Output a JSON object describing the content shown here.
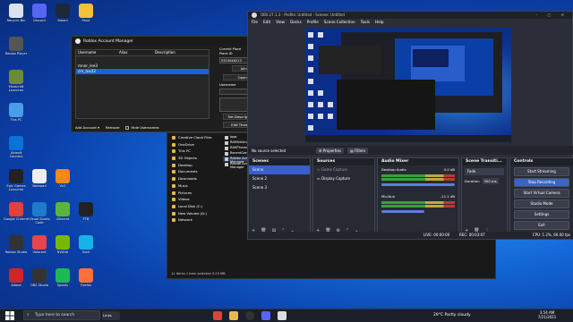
{
  "desktop": {
    "icons": [
      {
        "label": "Recycle Bin",
        "color": "#d9e2ee"
      },
      {
        "label": "Roblox Player",
        "color": "#555"
      },
      {
        "label": "Minecraft Launcher",
        "color": "#6b8a3a"
      },
      {
        "label": "This PC",
        "color": "#4a9de8"
      },
      {
        "label": "Ubisoft Connect",
        "color": "#0a73d8"
      },
      {
        "label": "Epic Games Launcher",
        "color": "#222"
      },
      {
        "label": "Google Chrome",
        "color": "#e0413a"
      },
      {
        "label": "Roblox Studio",
        "color": "#333"
      },
      {
        "label": "Adobe",
        "color": "#d0232a"
      },
      {
        "label": "Discord",
        "color": "#5865f2"
      },
      {
        "label": "Notepad",
        "color": "#eee"
      },
      {
        "label": "Visual Studio Code",
        "color": "#1f7acc"
      },
      {
        "label": "Valorant",
        "color": "#e5454f"
      },
      {
        "label": "OBS Studio",
        "color": "#333"
      },
      {
        "label": "Steam",
        "color": "#1b2838"
      },
      {
        "label": "VLC",
        "color": "#f08a1c"
      },
      {
        "label": "uTorrent",
        "color": "#5bb53c"
      },
      {
        "label": "NVIDIA",
        "color": "#76b900"
      },
      {
        "label": "Spotify",
        "color": "#1db954"
      },
      {
        "label": "Paint",
        "color": "#f4c037"
      },
      {
        "label": "FTB",
        "color": "#222"
      },
      {
        "label": "Kodi",
        "color": "#17b2e7"
      },
      {
        "label": "Firefox",
        "color": "#ff7139"
      },
      {
        "label": "Shortcut",
        "color": "#eee"
      }
    ]
  },
  "ram": {
    "title": "Roblox Account Manager",
    "columns": [
      "Username",
      "Alias",
      "Description"
    ],
    "accounts": [
      "mnor_lee3",
      "cm_lux22"
    ],
    "current_place_label": "Current Place",
    "place_id_label": "Place ID",
    "place_id": "5315046213",
    "userid_label": "UserID",
    "job_id_label": "Job ID",
    "buttons": {
      "join_server": "Join Server",
      "utilities": "Utilities",
      "open_browser": "Open Browser",
      "follow": "Follow",
      "set_alias": "Set Alias",
      "set_description": "Set Description",
      "account_utilities": "Account Utilities",
      "edit_theme": "Edit Theme",
      "account_control": "Account Control",
      "add_account": "Add Account",
      "remove": "Remove",
      "hide_usernames": "Hide Usernames"
    },
    "username_label": "Username"
  },
  "explorer": {
    "nav": [
      "Creative Cloud Files",
      "OneDrive",
      "This PC",
      "3D Objects",
      "Desktop",
      "Documents",
      "Downloads",
      "Music",
      "Pictures",
      "Videos",
      "Local Disk (C:)",
      "New Volume (D:)",
      "Network"
    ],
    "files": [
      "logs",
      "RAMSettings",
      "RAMTheme",
      "RecentGames",
      "Roblox Account Manager",
      "Roblox Account Manager"
    ],
    "status": "11 items    1 item selected  3.23 MB"
  },
  "obs": {
    "title": "OBS 27.1.3 - Profile: Untitled - Scenes: Untitled",
    "menu": [
      "File",
      "Edit",
      "View",
      "Docks",
      "Profile",
      "Scene Collection",
      "Tools",
      "Help"
    ],
    "no_source": "No source selected",
    "properties": "Properties",
    "filters": "Filters",
    "scenes": {
      "title": "Scenes",
      "items": [
        "Scene",
        "Scene 2",
        "Scene 3"
      ]
    },
    "sources": {
      "title": "Sources",
      "items": [
        "Game Capture",
        "Display Capture"
      ]
    },
    "mixer": {
      "title": "Audio Mixer",
      "channels": [
        {
          "name": "Desktop Audio",
          "level": "0.0 dB"
        },
        {
          "name": "Mic/Aux",
          "level": "-11.1 dB"
        }
      ]
    },
    "transitions": {
      "title": "Scene Transiti...",
      "type": "Fade",
      "duration_label": "Duration",
      "duration": "300 ms"
    },
    "controls": {
      "title": "Controls",
      "buttons": [
        "Start Streaming",
        "Stop Recording",
        "Start Virtual Camera",
        "Studio Mode",
        "Settings",
        "Exit"
      ]
    },
    "status": {
      "live": "LIVE: 00:00:00",
      "rec": "REC: 00:03:07",
      "cpu": "CPU: 1.2%, 60.00 fps"
    }
  },
  "taskbar": {
    "search_placeholder": "Type here to search",
    "weather": "29°C  Partly cloudy",
    "time": "3:54 AM",
    "date": "7/21/2021",
    "app_label": "Links"
  }
}
